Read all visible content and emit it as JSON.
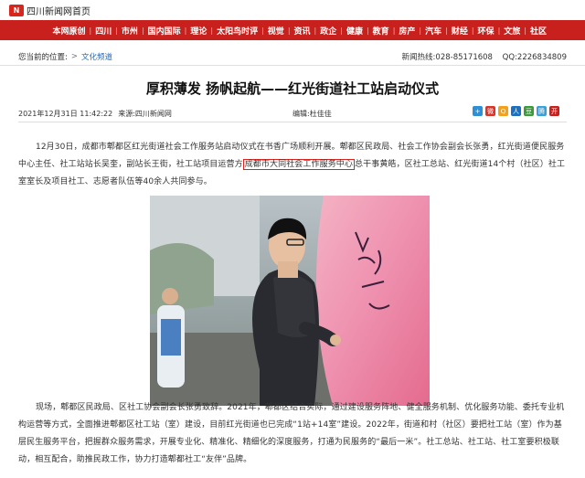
{
  "site": {
    "logo_text": "四川新闻网首页"
  },
  "nav": {
    "items": [
      "本网原创",
      "四川",
      "市州",
      "国内国际",
      "理论",
      "太阳鸟时评",
      "视觉",
      "资讯",
      "政企",
      "健康",
      "教育",
      "房产",
      "汽车",
      "财经",
      "环保",
      "文旅",
      "社区"
    ]
  },
  "crumb": {
    "label": "您当前的位置:",
    "section": "文化频道",
    "sep": ">",
    "hotline": "新闻热线:028-85171608",
    "qq": "QQ:2226834809"
  },
  "article": {
    "title": "厚积薄发 扬帆起航——红光街道社工站启动仪式",
    "datetime": "2021年12月31日 11:42:22",
    "source": "来源:四川新闻网",
    "editor": "编辑:杜佳佳",
    "p1_before": "12月30日，成都市郫都区红光街道社会工作服务站启动仪式在书香广场顺利开展。郫都区民政局、社会工作协会副会长张勇，红光街道便民服务中心主任、社工站站长吴奎，副站长王街，社工站项目运营方",
    "p1_highlight": "成都市大同社会工作服务中心",
    "p1_after": "总干事黄皓，区社工总站、红光街道14个村（社区）社工室室长及项目社工、志愿者队伍等40余人共同参与。",
    "p2": "现场，郫都区民政局、区社工协会副会长张勇致辞。2021年，郫都区结合实际，通过建设服务阵地、健全服务机制、优化服务功能、委托专业机构运营等方式，全面推进郫都区社工站（室）建设，目前红光街道也已完成“1站+14室”建设。2022年，街道和村（社区）要把社工站（室）作为基层民生服务平台，把握群众服务需求，开展专业化、精准化、精细化的深度服务，打通为民服务的“最后一米”。社工总站、社工站、社工室要积极联动，相互配合，助推民政工作，协力打造郫都社工“友伴”品牌。"
  },
  "share_icons": [
    {
      "name": "add-share-icon",
      "color": "#2d8fd6",
      "glyph": "+"
    },
    {
      "name": "weibo-share-icon",
      "color": "#d9352b",
      "glyph": "微"
    },
    {
      "name": "qzone-share-icon",
      "color": "#f2a11f",
      "glyph": "Q"
    },
    {
      "name": "renren-share-icon",
      "color": "#1f6fc0",
      "glyph": "人"
    },
    {
      "name": "douban-share-icon",
      "color": "#3b9b3a",
      "glyph": "豆"
    },
    {
      "name": "tencent-share-icon",
      "color": "#3aa0d8",
      "glyph": "腾"
    },
    {
      "name": "kaixin-share-icon",
      "color": "#c8201c",
      "glyph": "开"
    }
  ]
}
